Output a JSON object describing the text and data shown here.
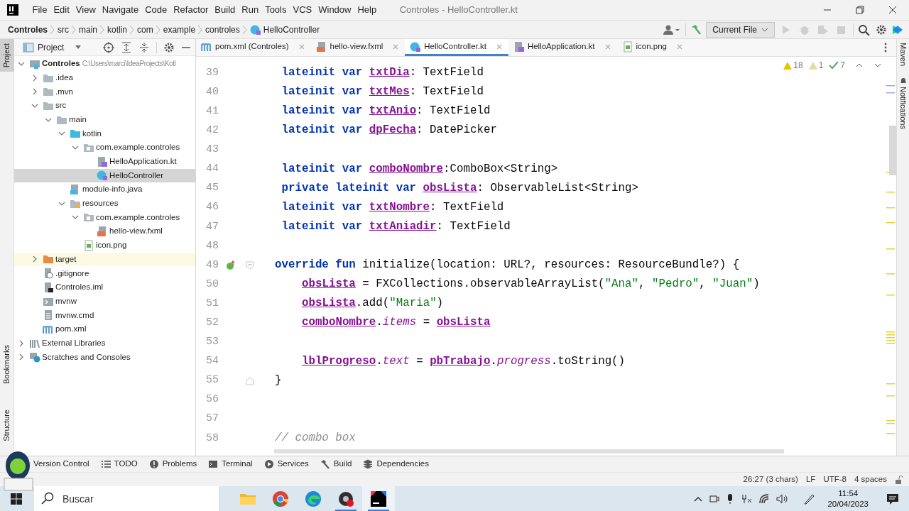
{
  "window": {
    "title": "Controles - HelloController.kt"
  },
  "menu": [
    "File",
    "Edit",
    "View",
    "Navigate",
    "Code",
    "Refactor",
    "Build",
    "Run",
    "Tools",
    "VCS",
    "Window",
    "Help"
  ],
  "breadcrumb": [
    {
      "label": "Controles",
      "kind": "root"
    },
    {
      "label": "src",
      "kind": "dir"
    },
    {
      "label": "main",
      "kind": "dir"
    },
    {
      "label": "kotlin",
      "kind": "dir"
    },
    {
      "label": "com",
      "kind": "dir"
    },
    {
      "label": "example",
      "kind": "dir"
    },
    {
      "label": "controles",
      "kind": "dir"
    },
    {
      "label": "HelloController",
      "kind": "class"
    }
  ],
  "run_config": "Current File",
  "left_tools_top": [
    {
      "label": "Project",
      "selected": true
    }
  ],
  "left_tools_bottom": [
    {
      "label": "Bookmarks",
      "selected": false
    },
    {
      "label": "Structure",
      "selected": false
    }
  ],
  "project_panel": {
    "title": "Project",
    "tree": [
      {
        "label": "Controles",
        "path": "C:\\Users\\marci\\IdeaProjects\\Kotl",
        "kind": "module",
        "expanded": true,
        "selected": false,
        "children": [
          {
            "label": ".idea",
            "kind": "folder",
            "expanded": false,
            "selected": false
          },
          {
            "label": ".mvn",
            "kind": "folder",
            "expanded": false,
            "selected": false
          },
          {
            "label": "src",
            "kind": "folder",
            "expanded": true,
            "selected": false,
            "children": [
              {
                "label": "main",
                "kind": "folder",
                "expanded": true,
                "selected": false,
                "children": [
                  {
                    "label": "kotlin",
                    "kind": "source-folder",
                    "expanded": true,
                    "selected": false,
                    "children": [
                      {
                        "label": "com.example.controles",
                        "kind": "package",
                        "expanded": true,
                        "selected": false,
                        "children": [
                          {
                            "label": "HelloApplication.kt",
                            "kind": "kotlin-file",
                            "selected": false
                          },
                          {
                            "label": "HelloController",
                            "kind": "kotlin-class",
                            "selected": true
                          }
                        ]
                      }
                    ]
                  },
                  {
                    "label": "module-info.java",
                    "kind": "java-file",
                    "selected": false
                  },
                  {
                    "label": "resources",
                    "kind": "resources-folder",
                    "expanded": true,
                    "selected": false,
                    "children": [
                      {
                        "label": "com.example.controles",
                        "kind": "package",
                        "expanded": true,
                        "selected": false,
                        "children": [
                          {
                            "label": "hello-view.fxml",
                            "kind": "fxml-file",
                            "selected": false
                          }
                        ]
                      },
                      {
                        "label": "icon.png",
                        "kind": "image-file",
                        "selected": false
                      }
                    ]
                  }
                ]
              }
            ]
          },
          {
            "label": "target",
            "kind": "excluded-folder",
            "expanded": false,
            "selected": false
          },
          {
            "label": ".gitignore",
            "kind": "ignore-file",
            "selected": false
          },
          {
            "label": "Controles.iml",
            "kind": "iml-file",
            "selected": false
          },
          {
            "label": "mvnw",
            "kind": "script-file",
            "selected": false
          },
          {
            "label": "mvnw.cmd",
            "kind": "text-file",
            "selected": false
          },
          {
            "label": "pom.xml",
            "kind": "maven",
            "selected": false
          }
        ]
      },
      {
        "label": "External Libraries",
        "kind": "libraries",
        "expanded": false,
        "selected": false
      },
      {
        "label": "Scratches and Consoles",
        "kind": "scratches",
        "expanded": false,
        "selected": false
      }
    ]
  },
  "editor_tabs": [
    {
      "label": "pom.xml (Controles)",
      "kind": "maven",
      "selected": false
    },
    {
      "label": "hello-view.fxml",
      "kind": "fxml-file",
      "selected": false
    },
    {
      "label": "HelloController.kt",
      "kind": "kotlin-class",
      "selected": true
    },
    {
      "label": "HelloApplication.kt",
      "kind": "kotlin-file",
      "selected": false
    },
    {
      "label": "icon.png",
      "kind": "image-file",
      "selected": false
    }
  ],
  "inspections": {
    "warnings": "18",
    "weak_warnings": "1",
    "typos": "7"
  },
  "code_lines": [
    {
      "number": "39",
      "kind": "field",
      "tokens": [
        {
          "kind": "kw",
          "text": "lateinit var "
        },
        {
          "kind": "prop",
          "text": "txtDia"
        },
        {
          "kind": "plain",
          "text": ": TextField"
        }
      ]
    },
    {
      "number": "40",
      "kind": "field",
      "tokens": [
        {
          "kind": "kw",
          "text": "lateinit var "
        },
        {
          "kind": "prop",
          "text": "txtMes"
        },
        {
          "kind": "plain",
          "text": ": TextField"
        }
      ]
    },
    {
      "number": "41",
      "kind": "field",
      "tokens": [
        {
          "kind": "kw",
          "text": "lateinit var "
        },
        {
          "kind": "prop",
          "text": "txtAnio"
        },
        {
          "kind": "plain",
          "text": ": TextField"
        }
      ]
    },
    {
      "number": "42",
      "kind": "field",
      "tokens": [
        {
          "kind": "kw",
          "text": "lateinit var "
        },
        {
          "kind": "prop",
          "text": "dpFecha"
        },
        {
          "kind": "plain",
          "text": ": DatePicker"
        }
      ]
    },
    {
      "number": "43",
      "kind": "blank"
    },
    {
      "number": "44",
      "kind": "field",
      "tokens": [
        {
          "kind": "kw",
          "text": "lateinit var "
        },
        {
          "kind": "prop",
          "text": "comboNombre"
        },
        {
          "kind": "plain",
          "text": ":ComboBox<String>"
        }
      ]
    },
    {
      "number": "45",
      "kind": "field",
      "tokens": [
        {
          "kind": "kw",
          "text": "private lateinit var "
        },
        {
          "kind": "prop",
          "text": "obsLista"
        },
        {
          "kind": "plain",
          "text": ": ObservableList<String>"
        }
      ]
    },
    {
      "number": "46",
      "kind": "field",
      "tokens": [
        {
          "kind": "kw",
          "text": "lateinit var "
        },
        {
          "kind": "prop",
          "text": "txtNombre"
        },
        {
          "kind": "plain",
          "text": ": TextField"
        }
      ]
    },
    {
      "number": "47",
      "kind": "field",
      "tokens": [
        {
          "kind": "kw",
          "text": "lateinit var "
        },
        {
          "kind": "prop",
          "text": "txtAniadir"
        },
        {
          "kind": "plain",
          "text": ": TextField"
        }
      ]
    },
    {
      "number": "48",
      "kind": "blank"
    },
    {
      "number": "49",
      "kind": "method-start",
      "tokens": [
        {
          "kind": "kw",
          "text": "override fun "
        },
        {
          "kind": "plain",
          "text": "initialize(location: URL?, resources: ResourceBundle?) {"
        }
      ],
      "children": [
        {
          "number": "50",
          "tokens": [
            {
              "kind": "prop",
              "text": "obsLista"
            },
            {
              "kind": "plain",
              "text": " = FXCollections.observableArrayList("
            },
            {
              "kind": "str",
              "text": "\"Ana\""
            },
            {
              "kind": "plain",
              "text": ", "
            },
            {
              "kind": "str",
              "text": "\"Pedro\""
            },
            {
              "kind": "plain",
              "text": ", "
            },
            {
              "kind": "str",
              "text": "\"Juan\""
            },
            {
              "kind": "plain",
              "text": ")"
            }
          ]
        },
        {
          "number": "51",
          "tokens": [
            {
              "kind": "prop",
              "text": "obsLista"
            },
            {
              "kind": "plain",
              "text": ".add("
            },
            {
              "kind": "str",
              "text": "\"Maria\""
            },
            {
              "kind": "plain",
              "text": ")"
            }
          ]
        },
        {
          "number": "52",
          "tokens": [
            {
              "kind": "prop",
              "text": "comboNombre"
            },
            {
              "kind": "plain",
              "text": "."
            },
            {
              "kind": "synthetic",
              "text": "items"
            },
            {
              "kind": "plain",
              "text": " = "
            },
            {
              "kind": "prop",
              "text": "obsLista"
            }
          ]
        },
        {
          "number": "53"
        },
        {
          "number": "54",
          "tokens": [
            {
              "kind": "prop",
              "text": "lblProgreso"
            },
            {
              "kind": "plain",
              "text": "."
            },
            {
              "kind": "synthetic",
              "text": "text"
            },
            {
              "kind": "plain",
              "text": " = "
            },
            {
              "kind": "prop",
              "text": "pbTrabajo"
            },
            {
              "kind": "plain",
              "text": "."
            },
            {
              "kind": "synthetic",
              "text": "progress"
            },
            {
              "kind": "plain",
              "text": ".toString()"
            }
          ]
        }
      ]
    },
    {
      "number": "55",
      "kind": "method-end",
      "tokens": [
        {
          "kind": "plain",
          "text": "}"
        }
      ]
    },
    {
      "number": "56",
      "kind": "blank"
    },
    {
      "number": "57",
      "kind": "blank"
    },
    {
      "number": "58",
      "kind": "comment",
      "tokens": [
        {
          "kind": "comment",
          "text": "// combo box"
        }
      ]
    }
  ],
  "right_tools": [
    "Maven",
    "Notifications"
  ],
  "tool_windows": [
    {
      "label": "Version Control",
      "kind": "none"
    },
    {
      "label": "TODO",
      "kind": "list"
    },
    {
      "label": "Problems",
      "kind": "problems"
    },
    {
      "label": "Terminal",
      "kind": "terminal"
    },
    {
      "label": "Services",
      "kind": "services"
    },
    {
      "label": "Build",
      "kind": "hammer"
    },
    {
      "label": "Dependencies",
      "kind": "layers"
    }
  ],
  "status_bar": [
    "26:27 (3 chars)",
    "LF",
    "UTF-8",
    "4 spaces"
  ],
  "taskbar": {
    "search_placeholder": "Buscar",
    "apps": [
      {
        "kind": "explorer",
        "running": false,
        "selected": false
      },
      {
        "kind": "chrome",
        "running": false,
        "selected": false
      },
      {
        "kind": "edge",
        "running": false,
        "selected": false
      },
      {
        "kind": "recorder",
        "running": true,
        "selected": false
      },
      {
        "kind": "ide",
        "running": true,
        "selected": true
      }
    ],
    "time": "11:54",
    "date": "20/04/2023"
  }
}
